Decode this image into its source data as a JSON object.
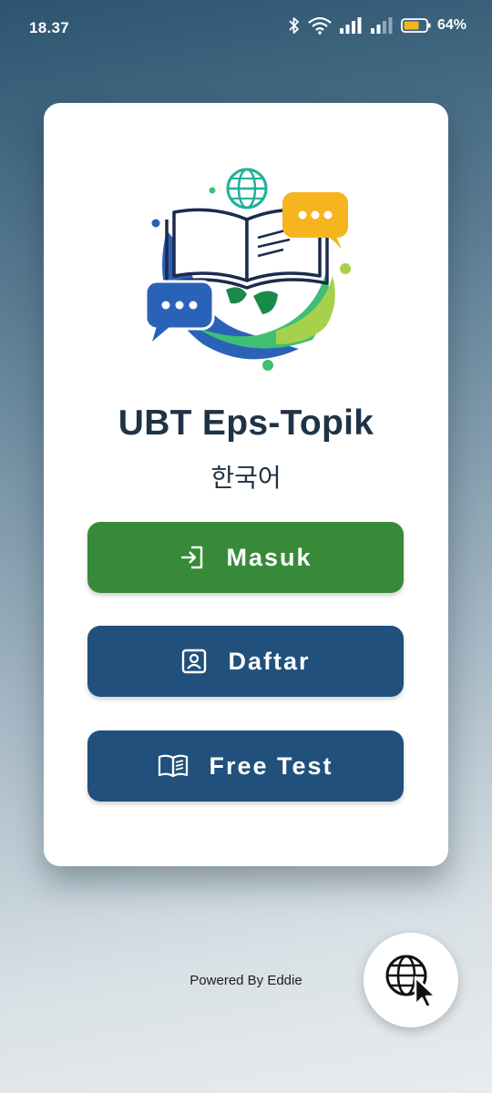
{
  "status_bar": {
    "time": "18.37",
    "battery_percent": "64%",
    "icons": [
      "bluetooth-icon",
      "wifi-icon",
      "signal-icon",
      "signal-weak-icon",
      "battery-icon"
    ]
  },
  "app": {
    "title": "UBT Eps-Topik",
    "subtitle": "한국어",
    "logo_icon": "book-globe-chat-logo"
  },
  "buttons": {
    "masuk_label": "Masuk",
    "daftar_label": "Daftar",
    "free_test_label": "Free Test"
  },
  "footer": {
    "powered_by": "Powered By Eddie"
  },
  "fab": {
    "icon": "globe-cursor-icon"
  },
  "colors": {
    "primary_green": "#378a38",
    "primary_blue": "#20507b",
    "title_text": "#1f3346"
  }
}
